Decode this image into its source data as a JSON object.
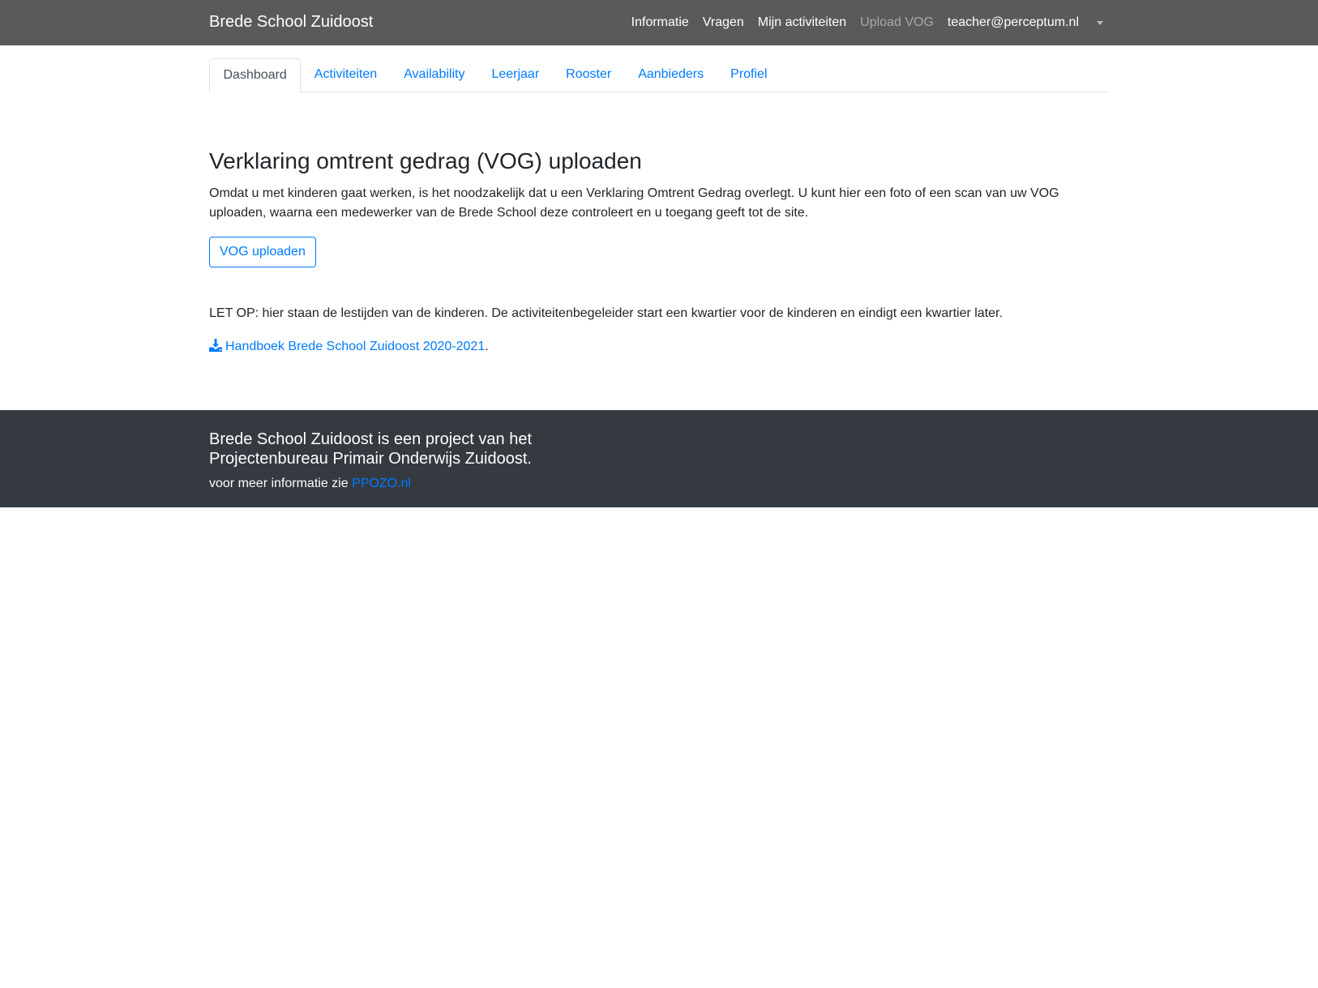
{
  "navbar": {
    "brand": "Brede School Zuidoost",
    "links": [
      "Informatie",
      "Vragen",
      "Mijn activiteiten",
      "Upload VOG",
      "teacher@perceptum.nl"
    ]
  },
  "tabs": [
    "Dashboard",
    "Activiteiten",
    "Availability",
    "Leerjaar",
    "Rooster",
    "Aanbieders",
    "Profiel"
  ],
  "main": {
    "title": "Verklaring omtrent gedrag (VOG) uploaden",
    "intro": "Omdat u met kinderen gaat werken, is het noodzakelijk dat u een Verklaring Omtrent Gedrag overlegt. U kunt hier een foto of een scan van uw VOG uploaden, waarna een medewerker van de Brede School deze controleert en u toegang geeft tot de site.",
    "button_label": "VOG uploaden",
    "note": "LET OP: hier staan de lestijden van de kinderen. De activiteitenbegeleider start een kwartier voor de kinderen en eindigt een kwartier later.",
    "handbook_link": "Handboek Brede School Zuidoost 2020-2021",
    "handbook_suffix": "."
  },
  "footer": {
    "line1": "Brede School Zuidoost is een project van het",
    "line2": "Projectenbureau Primair Onderwijs Zuidoost.",
    "more_prefix": "voor meer informatie zie ",
    "more_link": "PPOZO.nl"
  },
  "icons": {
    "download": "download-icon",
    "caret": "chevron-down-icon"
  },
  "colors": {
    "navbar": "#5a5a5a",
    "link": "#007bff",
    "footer": "#343a40"
  }
}
